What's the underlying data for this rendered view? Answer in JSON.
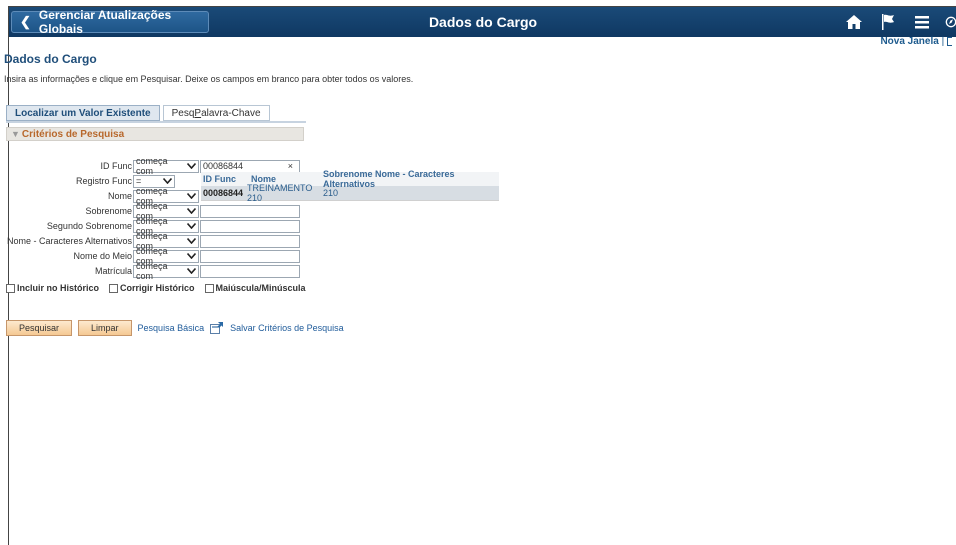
{
  "header": {
    "back_label": "Gerenciar Atualizações Globais",
    "title": "Dados do Cargo"
  },
  "nova_janela": "Nova Janela",
  "nova_sep": "|",
  "page_title": "Dados do Cargo",
  "instructions": "Insira as informações e clique em Pesquisar. Deixe os campos em branco para obter todos os valores.",
  "tabs": [
    {
      "label": "Localizar um Valor Existente",
      "active": true
    },
    {
      "label_pre": "Pesq ",
      "label_u": "P",
      "label_post": "alavra-Chave",
      "active": false
    }
  ],
  "criteria_title": "Critérios de Pesquisa",
  "fields": [
    {
      "label": "ID Func",
      "operator": "começa com",
      "value": "00086844"
    },
    {
      "label": "Registro Func",
      "operator": "=",
      "value": ""
    },
    {
      "label": "Nome",
      "operator": "começa com",
      "value": ""
    },
    {
      "label": "Sobrenome",
      "operator": "começa com",
      "value": ""
    },
    {
      "label": "Segundo Sobrenome",
      "operator": "começa com",
      "value": ""
    },
    {
      "label": "Nome - Caracteres Alternativos",
      "operator": "começa com",
      "value": ""
    },
    {
      "label": "Nome do Meio",
      "operator": "começa com",
      "value": ""
    },
    {
      "label": "Matrícula",
      "operator": "começa com",
      "value": ""
    }
  ],
  "clear_x": "×",
  "dropdown": {
    "headers": [
      "ID Func",
      "Nome",
      "Sobrenome Nome - Caracteres Alternativos"
    ],
    "row": {
      "id": "00086844",
      "nome": "TREINAMENTO 210",
      "sobrenome": "210"
    }
  },
  "checkboxes": [
    {
      "label": "Incluir no Histórico",
      "checked": false
    },
    {
      "label": "Corrigir Histórico",
      "checked": false
    },
    {
      "label": "Maiúscula/Minúscula",
      "checked": false
    }
  ],
  "buttons": {
    "search": "Pesquisar",
    "clear": "Limpar",
    "basic_search": "Pesquisa Básica",
    "save_criteria": "Salvar Critérios de Pesquisa"
  },
  "colors": {
    "header": "#1a4a78",
    "accent": "#b8682c",
    "link": "#1f5b9a"
  }
}
